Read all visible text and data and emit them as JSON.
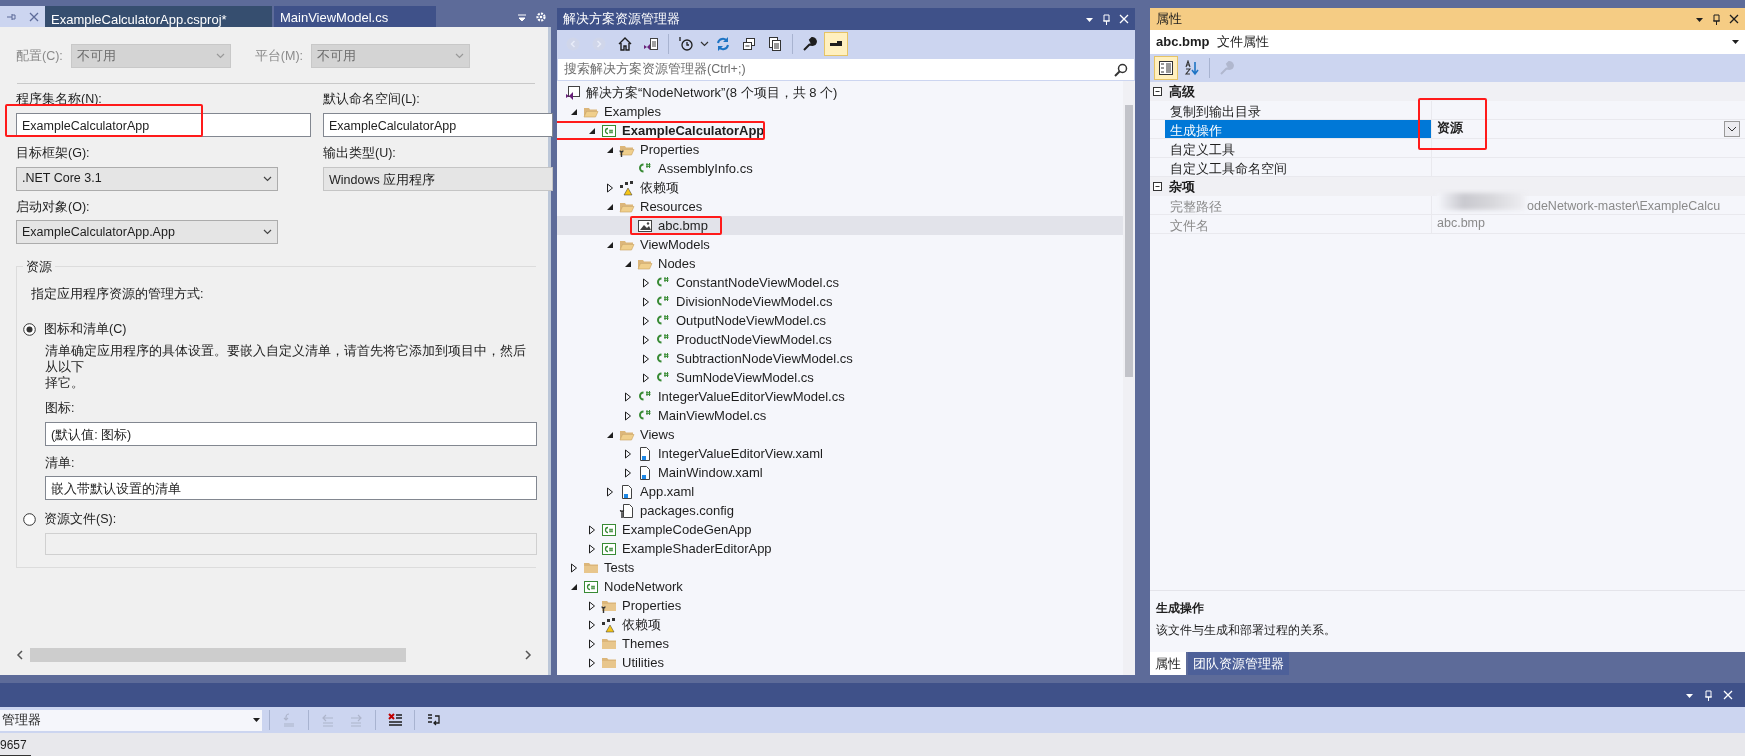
{
  "editor": {
    "tabs": [
      {
        "label": "ExampleCalculatorApp.csproj*",
        "selected": true
      },
      {
        "label": "MainViewModel.cs",
        "selected": false
      }
    ],
    "config": {
      "label": "配置(C):",
      "value": "不可用",
      "disabled": true
    },
    "platform": {
      "label": "平台(M):",
      "value": "不可用",
      "disabled": true
    },
    "assembly_name": {
      "label": "程序集名称(N):",
      "value": "ExampleCalculatorApp",
      "annotated": true
    },
    "default_namespace": {
      "label": "默认命名空间(L):",
      "value": "ExampleCalculatorApp"
    },
    "target_framework": {
      "label": "目标框架(G):",
      "value": ".NET Core 3.1"
    },
    "output_type": {
      "label": "输出类型(U):",
      "value": "Windows 应用程序"
    },
    "startup_object": {
      "label": "启动对象(O):",
      "value": "ExampleCalculatorApp.App"
    },
    "resources": {
      "title": "资源",
      "hint": "指定应用程序资源的管理方式:",
      "options": [
        {
          "label": "图标和清单(C)",
          "selected": true,
          "note_lines": [
            "清单确定应用程序的具体设置。要嵌入自定义清单，请首先将它添加到项目中，然后从以下",
            "择它。"
          ],
          "fields": [
            {
              "label": "图标:",
              "value": "(默认值: 图标)"
            },
            {
              "label": "清单:",
              "value": "嵌入带默认设置的清单"
            }
          ]
        },
        {
          "label": "资源文件(S):",
          "selected": false
        }
      ]
    }
  },
  "solution_explorer": {
    "title": "解决方案资源管理器",
    "toolbar": [
      {
        "kind": "back",
        "disabled": true,
        "pressed": false
      },
      {
        "kind": "forward",
        "disabled": true,
        "pressed": false
      },
      {
        "kind": "home",
        "disabled": false,
        "pressed": false
      },
      {
        "kind": "switch-views",
        "disabled": false,
        "pressed": false
      },
      {
        "kind": "pending-changes",
        "disabled": false,
        "pressed": false
      },
      {
        "kind": "sync",
        "disabled": false,
        "pressed": false
      },
      {
        "kind": "collapse-all",
        "disabled": false,
        "pressed": false
      },
      {
        "kind": "show-all",
        "disabled": false,
        "pressed": false
      },
      {
        "kind": "properties",
        "disabled": false,
        "pressed": false
      },
      {
        "kind": "preview",
        "disabled": false,
        "pressed": true
      }
    ],
    "search": {
      "placeholder": "搜索解决方案资源管理器(Ctrl+;)"
    },
    "solution": {
      "label": "解决方案“NodeNetwork”(8 个项目，共 8 个)",
      "selected": false
    },
    "tree": [
      {
        "label": "Examples",
        "kind": "folder",
        "expanded": true,
        "selected": false,
        "children": [
          {
            "label": "ExampleCalculatorApp",
            "kind": "project",
            "expanded": true,
            "selected": false,
            "startup": true,
            "annotated": true,
            "children": [
              {
                "label": "Properties",
                "kind": "properties",
                "expanded": true,
                "selected": false,
                "children": [
                  {
                    "label": "AssemblyInfo.cs",
                    "kind": "csharp",
                    "selected": false
                  }
                ]
              },
              {
                "label": "依赖项",
                "kind": "dependencies",
                "expanded": false,
                "selected": false
              },
              {
                "label": "Resources",
                "kind": "folder",
                "expanded": true,
                "selected": false,
                "children": [
                  {
                    "label": "abc.bmp",
                    "kind": "image",
                    "selected": true,
                    "annotated": true
                  }
                ]
              },
              {
                "label": "ViewModels",
                "kind": "folder",
                "expanded": true,
                "selected": false,
                "children": [
                  {
                    "label": "Nodes",
                    "kind": "folder",
                    "expanded": true,
                    "selected": false,
                    "children": [
                      {
                        "label": "ConstantNodeViewModel.cs",
                        "kind": "csharp",
                        "expanded": false,
                        "selected": false
                      },
                      {
                        "label": "DivisionNodeViewModel.cs",
                        "kind": "csharp",
                        "expanded": false,
                        "selected": false
                      },
                      {
                        "label": "OutputNodeViewModel.cs",
                        "kind": "csharp",
                        "expanded": false,
                        "selected": false
                      },
                      {
                        "label": "ProductNodeViewModel.cs",
                        "kind": "csharp",
                        "expanded": false,
                        "selected": false
                      },
                      {
                        "label": "SubtractionNodeViewModel.cs",
                        "kind": "csharp",
                        "expanded": false,
                        "selected": false
                      },
                      {
                        "label": "SumNodeViewModel.cs",
                        "kind": "csharp",
                        "expanded": false,
                        "selected": false
                      }
                    ]
                  },
                  {
                    "label": "IntegerValueEditorViewModel.cs",
                    "kind": "csharp",
                    "expanded": false,
                    "selected": false
                  },
                  {
                    "label": "MainViewModel.cs",
                    "kind": "csharp",
                    "expanded": false,
                    "selected": false
                  }
                ]
              },
              {
                "label": "Views",
                "kind": "folder",
                "expanded": true,
                "selected": false,
                "children": [
                  {
                    "label": "IntegerValueEditorView.xaml",
                    "kind": "xaml",
                    "expanded": false,
                    "selected": false
                  },
                  {
                    "label": "MainWindow.xaml",
                    "kind": "xaml",
                    "expanded": false,
                    "selected": false
                  }
                ]
              },
              {
                "label": "App.xaml",
                "kind": "xaml",
                "expanded": false,
                "selected": false
              },
              {
                "label": "packages.config",
                "kind": "config",
                "selected": false
              }
            ]
          },
          {
            "label": "ExampleCodeGenApp",
            "kind": "project",
            "expanded": false,
            "selected": false,
            "startup": false
          },
          {
            "label": "ExampleShaderEditorApp",
            "kind": "project",
            "expanded": false,
            "selected": false,
            "startup": false
          }
        ]
      },
      {
        "label": "Tests",
        "kind": "folder",
        "expanded": false,
        "selected": false
      },
      {
        "label": "NodeNetwork",
        "kind": "project",
        "expanded": true,
        "selected": false,
        "startup": false,
        "children": [
          {
            "label": "Properties",
            "kind": "properties",
            "expanded": false,
            "selected": false
          },
          {
            "label": "依赖项",
            "kind": "dependencies",
            "expanded": false,
            "selected": false
          },
          {
            "label": "Themes",
            "kind": "folder",
            "expanded": false,
            "selected": false
          },
          {
            "label": "Utilities",
            "kind": "folder",
            "expanded": false,
            "selected": false
          }
        ]
      }
    ]
  },
  "properties": {
    "title": "属性",
    "object_name": "abc.bmp",
    "object_type": "文件属性",
    "toolbar": [
      {
        "kind": "categorized",
        "disabled": false,
        "pressed": true
      },
      {
        "kind": "alphabetical",
        "disabled": false,
        "pressed": false
      },
      {
        "kind": "property-pages",
        "disabled": true,
        "pressed": false
      }
    ],
    "categories": [
      {
        "name": "高级",
        "expanded": true,
        "rows": [
          {
            "name": "复制到输出目录",
            "selected": false,
            "readonly": false
          },
          {
            "name": "生成操作",
            "value": "资源",
            "selected": true,
            "readonly": false,
            "modified": true,
            "annotated": true
          },
          {
            "name": "自定义工具",
            "selected": false,
            "readonly": false
          },
          {
            "name": "自定义工具命名空间",
            "selected": false,
            "readonly": false
          }
        ]
      },
      {
        "name": "杂项",
        "expanded": true,
        "rows": [
          {
            "name": "完整路径",
            "value": "odeNetwork-master\\ExampleCalcu",
            "selected": false,
            "readonly": true,
            "redacted_prefix": true
          },
          {
            "name": "文件名",
            "value": "abc.bmp",
            "selected": false,
            "readonly": true
          }
        ]
      }
    ],
    "description": {
      "title": "生成操作",
      "text": "该文件与生成和部署过程的关系。"
    },
    "tabs": [
      {
        "label": "属性",
        "selected": true
      },
      {
        "label": "团队资源管理器",
        "selected": false
      }
    ]
  },
  "output": {
    "source": "管理器",
    "toolbar": [
      {
        "kind": "goto",
        "disabled": true
      },
      {
        "kind": "previous",
        "disabled": true
      },
      {
        "kind": "next",
        "disabled": true
      },
      {
        "kind": "clear",
        "disabled": false
      },
      {
        "kind": "word-wrap",
        "disabled": false
      }
    ],
    "line": "9657"
  }
}
